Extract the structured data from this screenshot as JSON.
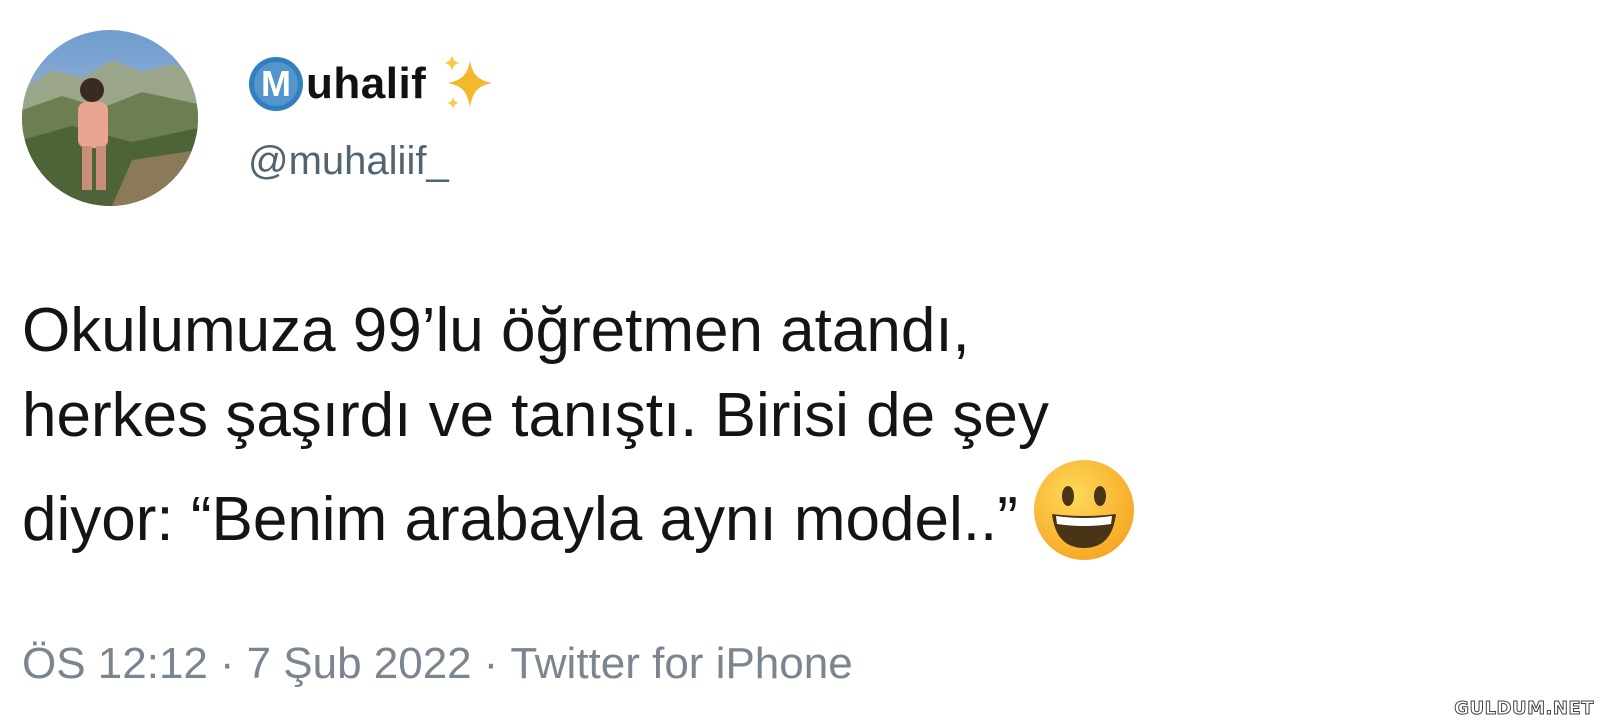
{
  "tweet": {
    "author": {
      "display_name": "uhalif",
      "logo_letter": "M",
      "handle": "@muhaliif_",
      "name_emoji": "sparkles-icon",
      "avatar": "profile-photo"
    },
    "text_lines": [
      "Okulumuza 99’lu öğretmen atandı,",
      "herkes şaşırdı ve tanıştı. Birisi de şey",
      "diyor: “Benim arabayla aynı model..”"
    ],
    "text_emoji": "grinning-face-icon",
    "meta": {
      "time": "ÖS 12:12",
      "date": "7 Şub 2022",
      "source": "Twitter for iPhone",
      "separator": "·"
    }
  },
  "watermark": "GULDUM.NET",
  "colors": {
    "logo_blue": "#2f7fc1",
    "sparkle_gold": "#f5b82a",
    "handle_gray": "#536471",
    "meta_gray": "#7a8590"
  }
}
